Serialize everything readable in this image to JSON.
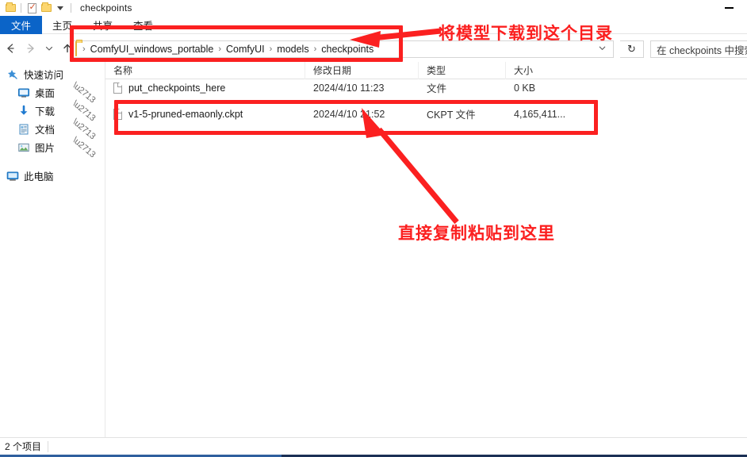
{
  "window": {
    "title": "checkpoints",
    "quick_access_icons": [
      "folder-icon",
      "properties-icon",
      "new-folder-icon",
      "customize-caret-icon"
    ],
    "controls": {
      "minimize_label": "—"
    }
  },
  "ribbon": {
    "tabs": [
      {
        "label": "文件",
        "active": true
      },
      {
        "label": "主页",
        "active": false
      },
      {
        "label": "共享",
        "active": false
      },
      {
        "label": "查看",
        "active": false
      }
    ]
  },
  "nav": {
    "back_icon": "back-arrow-icon",
    "forward_icon": "forward-arrow-icon",
    "recent_icon": "chevron-down-icon",
    "up_icon": "up-arrow-icon",
    "address": {
      "folder_icon": "folder-icon",
      "crumbs": [
        "ComfyUI_windows_portable",
        "ComfyUI",
        "models",
        "checkpoints"
      ],
      "separator": "›",
      "dropdown_icon": "chevron-down-icon"
    },
    "refresh_icon": "↻",
    "search": {
      "placeholder": "在 checkpoints 中搜索"
    }
  },
  "sidebar": {
    "items": [
      {
        "label": "快速访问",
        "icon": "star-pin-icon",
        "level": "root",
        "pinned": false
      },
      {
        "label": "桌面",
        "icon": "desktop-icon",
        "level": "sub",
        "pinned": true
      },
      {
        "label": "下载",
        "icon": "download-icon",
        "level": "sub",
        "pinned": true
      },
      {
        "label": "文档",
        "icon": "documents-icon",
        "level": "sub",
        "pinned": true
      },
      {
        "label": "图片",
        "icon": "pictures-icon",
        "level": "sub",
        "pinned": true
      },
      {
        "label": "此电脑",
        "icon": "this-pc-icon",
        "level": "root",
        "pinned": false
      }
    ]
  },
  "filelist": {
    "columns": [
      "名称",
      "修改日期",
      "类型",
      "大小"
    ],
    "rows": [
      {
        "name": "put_checkpoints_here",
        "date": "2024/4/10 11:23",
        "type": "文件",
        "size": "0 KB"
      },
      {
        "name": "v1-5-pruned-emaonly.ckpt",
        "date": "2024/4/10 21:52",
        "type": "CKPT 文件",
        "size": "4,165,411..."
      }
    ]
  },
  "status": {
    "items_text": "2 个项目"
  },
  "annotations": {
    "accent_color": "#fb2020",
    "top_note": "将模型下载到这个目录",
    "bottom_note": "直接复制粘贴到这里"
  }
}
